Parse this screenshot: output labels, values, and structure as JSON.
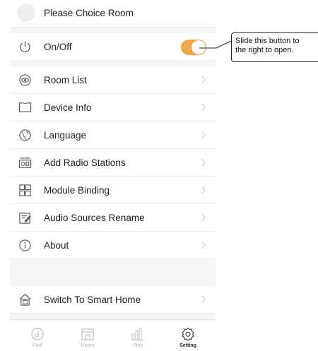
{
  "header": {
    "title": "Please Choice Room"
  },
  "power": {
    "label": "On/Off",
    "state": "on",
    "accent_color": "#f2a84a"
  },
  "callout": {
    "line1": "Slide this button to",
    "line2": "the right to open."
  },
  "menu": [
    {
      "label": "Room List",
      "icon": "eye-icon"
    },
    {
      "label": "Device Info",
      "icon": "screen-icon"
    },
    {
      "label": "Language",
      "icon": "globe-icon"
    },
    {
      "label": "Add Radio Stations",
      "icon": "radio-icon"
    },
    {
      "label": "Module Binding",
      "icon": "module-grid-icon"
    },
    {
      "label": "Audio Sources Rename",
      "icon": "edit-icon"
    },
    {
      "label": "About",
      "icon": "info-icon"
    }
  ],
  "smart_home": {
    "label": "Switch To Smart Home",
    "icon": "home-icon"
  },
  "tabs": [
    {
      "label": "Find",
      "icon": "find-icon",
      "active": false
    },
    {
      "label": "Room",
      "icon": "room-icon",
      "active": false
    },
    {
      "label": "Play",
      "icon": "play-bars-icon",
      "active": false
    },
    {
      "label": "Setting",
      "icon": "gear-icon",
      "active": true
    }
  ]
}
